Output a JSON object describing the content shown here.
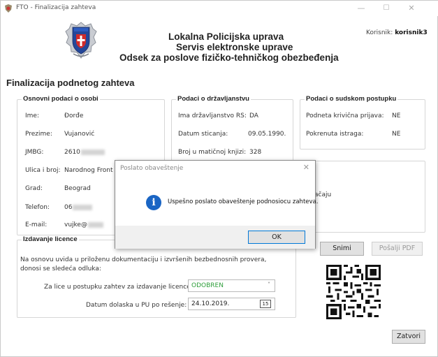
{
  "window": {
    "title": "FTO - Finalizacija zahteva",
    "minimize_glyph": "—",
    "maximize_glyph": "☐",
    "close_glyph": "✕"
  },
  "header": {
    "line1": "Lokalna Policijska uprava",
    "line2": "Servis elektronske uprave",
    "line3": "Odsek za poslove fizičko-tehničkog obezbeđenja",
    "user_label": "Korisnik:",
    "user_name": "korisnik3"
  },
  "page_title": "Finalizacija podnetog zahteva",
  "osnovni": {
    "title": "Osnovni podaci o osobi",
    "ime_label": "Ime:",
    "ime_value": "Đorđe",
    "prezime_label": "Prezime:",
    "prezime_value": "Vujanović",
    "jmbg_label": "JMBG:",
    "jmbg_value": "2610",
    "ulica_label": "Ulica i broj:",
    "ulica_value": "Narodnog Front",
    "grad_label": "Grad:",
    "grad_value": "Beograd",
    "telefon_label": "Telefon:",
    "telefon_value": "06",
    "email_label": "E-mail:",
    "email_value": "vujke@"
  },
  "drzavljanstvo": {
    "title": "Podaci o državljanstvu",
    "ima_label": "Ima državljanstvo RS:",
    "ima_value": "DA",
    "datum_label": "Datum sticanja:",
    "datum_value": "09.05.1990.",
    "broj_label": "Broj u matičnoj knjizi:",
    "broj_value": "328"
  },
  "sudski": {
    "title": "Podaci o sudskom postupku",
    "prijava_label": "Podneta krivična prijava:",
    "prijava_value": "NE",
    "istraga_label": "Pokrenuta istraga:",
    "istraga_value": "NE",
    "partial_text": "ačaju"
  },
  "licenca": {
    "title": "Izdavanje licence",
    "desc_line1": "Na osnovu uvida u priloženu dokumentaciju i izvršenih bezbednosnih provera,",
    "desc_line2": "donosi se sledeća odluka:",
    "odluka_label": "Za lice u postupku zahtev za izdavanje licence je:",
    "odluka_value": "ODOBREN",
    "odluka_color": "#2e9e3a",
    "datum_label": "Datum dolaska u PU po rešenje:",
    "datum_value": "24.10.2019.",
    "calendar_day": "15"
  },
  "buttons": {
    "snimi": "Snimi",
    "posalji_pdf": "Pošalji PDF",
    "zatvori": "Zatvori"
  },
  "dialog": {
    "title": "Poslato obaveštenje",
    "message": "Uspešno poslato obaveštenje podnosiocu zahteva.",
    "ok": "OK",
    "icon": "info-icon"
  }
}
